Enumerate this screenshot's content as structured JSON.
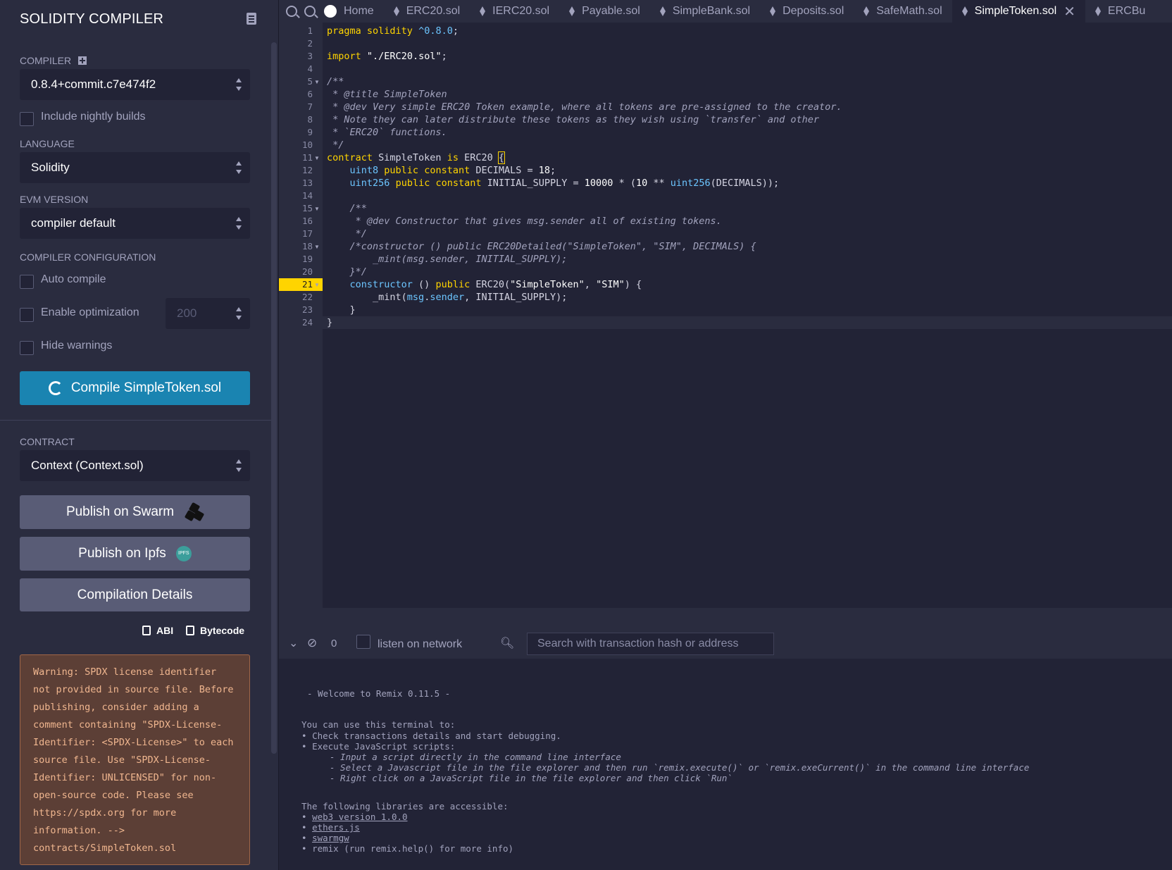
{
  "side": {
    "title": "SOLIDITY COMPILER",
    "compiler_label": "COMPILER",
    "compiler_value": "0.8.4+commit.c7e474f2",
    "nightly_label": "Include nightly builds",
    "language_label": "LANGUAGE",
    "language_value": "Solidity",
    "evm_label": "EVM VERSION",
    "evm_value": "compiler default",
    "config_label": "COMPILER CONFIGURATION",
    "auto_compile": "Auto compile",
    "enable_opt": "Enable optimization",
    "runs_value": "200",
    "hide_warnings": "Hide warnings",
    "compile_button": "Compile SimpleToken.sol",
    "contract_label": "CONTRACT",
    "contract_value": "Context (Context.sol)",
    "publish_swarm": "Publish on Swarm",
    "publish_ipfs": "Publish on Ipfs",
    "ipfs_badge": "IPFS",
    "compilation_details": "Compilation Details",
    "abi": "ABI",
    "bytecode": "Bytecode",
    "warning": "Warning: SPDX license identifier not provided in source file. Before publishing, consider adding a comment containing \"SPDX-License-Identifier: <SPDX-License>\" to each source file. Use \"SPDX-License-Identifier: UNLICENSED\" for non-open-source code. Please see https://spdx.org for more information. --> contracts/SimpleToken.sol"
  },
  "tabs": {
    "home": "Home",
    "files": [
      "ERC20.sol",
      "IERC20.sol",
      "Payable.sol",
      "SimpleBank.sol",
      "Deposits.sol",
      "SafeMath.sol",
      "SimpleToken.sol",
      "ERCBu"
    ],
    "active": "SimpleToken.sol"
  },
  "editor": {
    "line_numbers": [
      "1",
      "2",
      "3",
      "4",
      "5",
      "6",
      "7",
      "8",
      "9",
      "10",
      "11",
      "12",
      "13",
      "14",
      "15",
      "16",
      "17",
      "18",
      "19",
      "20",
      "21",
      "22",
      "23",
      "24"
    ],
    "highlight_line": "21"
  },
  "terminal": {
    "count": "0",
    "listen_label": "listen on network",
    "search_placeholder": "Search with transaction hash or address",
    "welcome": "- Welcome to Remix 0.11.5 -",
    "intro": "You can use this terminal to:",
    "bullet1": "Check transactions details and start debugging.",
    "bullet2": "Execute JavaScript scripts:",
    "sub1": "- Input a script directly in the command line interface",
    "sub2": "- Select a Javascript file in the file explorer and then run `remix.execute()` or `remix.exeCurrent()` in the command line interface",
    "sub3": "- Right click on a JavaScript file in the file explorer and then click `Run`",
    "libs_intro": "The following libraries are accessible:",
    "lib1": "web3 version 1.0.0",
    "lib2": "ethers.js",
    "lib3": "swarmgw",
    "lib4": "remix (run remix.help() for more info)"
  }
}
